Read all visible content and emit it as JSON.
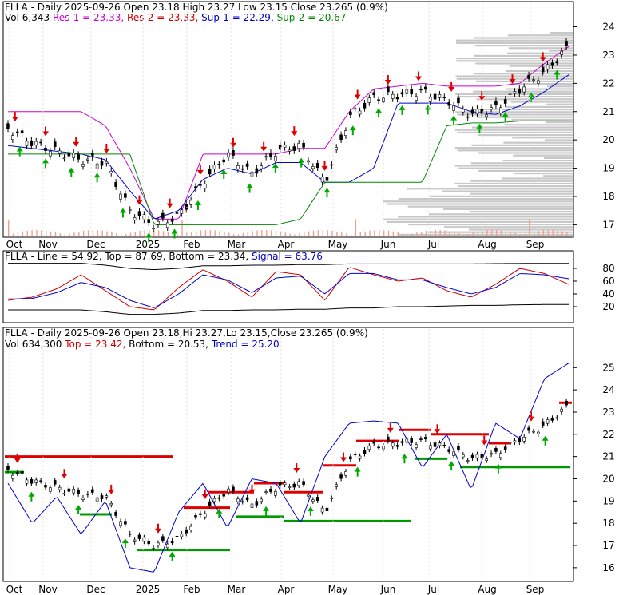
{
  "panels": {
    "top": {
      "header_line1": [
        {
          "text": "FLLA - Daily 2025-09-26 Open 23.18  High 23.27  Low 23.15  Close 23.265 (0.9%)",
          "color": "#000000"
        }
      ],
      "header_line2": [
        {
          "text": "Vol 6,343",
          "color": "#000000"
        },
        {
          "text": "Res-1 = 23.33,",
          "color": "#cc00cc"
        },
        {
          "text": "Res-2 = 23.33,",
          "color": "#cc0000"
        },
        {
          "text": "Sup-1 = 22.29,",
          "color": "#0000cc"
        },
        {
          "text": "Sup-2 = 20.67",
          "color": "#008800"
        }
      ],
      "y_ticks": [
        "24",
        "23",
        "22",
        "21",
        "20",
        "19",
        "18",
        "17"
      ],
      "x_ticks": [
        "Oct",
        "Nov",
        "Dec",
        "2025",
        "Feb",
        "Mar",
        "Apr",
        "May",
        "Jun",
        "Jul",
        "Aug",
        "Sep"
      ]
    },
    "middle": {
      "header": [
        {
          "text": "FLLA - Line = 54.92,",
          "color": "#000000"
        },
        {
          "text": "Top = 87.69,",
          "color": "#000000"
        },
        {
          "text": "Bottom = 23.34,",
          "color": "#000000"
        },
        {
          "text": "Signal = 63.76",
          "color": "#0000cc"
        }
      ],
      "y_ticks": [
        "80",
        "60",
        "40",
        "20"
      ]
    },
    "bottom": {
      "header_line1": [
        {
          "text": "FLLA - Daily 2025-09-26 Open 23.18,Hi 23.27,Lo 23.15,Close 23.265 (0.9%)",
          "color": "#000000"
        }
      ],
      "header_line2": [
        {
          "text": "Vol 634,300",
          "color": "#000000"
        },
        {
          "text": "Top = 23.42,",
          "color": "#cc0000"
        },
        {
          "text": "Bottom = 20.53,",
          "color": "#000000"
        },
        {
          "text": "Trend = 25.20",
          "color": "#0000cc"
        }
      ],
      "y_ticks": [
        "25",
        "24",
        "23",
        "22",
        "21",
        "20",
        "19",
        "18",
        "17",
        "16"
      ],
      "x_ticks": [
        "Oct",
        "Nov",
        "Dec",
        "2025",
        "Feb",
        "Mar",
        "Apr",
        "May",
        "Jun",
        "Jul",
        "Aug",
        "Sep"
      ]
    }
  },
  "chart_data": [
    {
      "type": "line",
      "panel": "price",
      "title": "FLLA - Daily 2025-09-26",
      "ylim": [
        16.7,
        24.1
      ],
      "x": [
        "Oct",
        "Oct",
        "Nov",
        "Nov",
        "Dec",
        "Dec",
        "2025",
        "2025",
        "Feb",
        "Feb",
        "Mar",
        "Mar",
        "Apr",
        "Apr",
        "May",
        "May",
        "Jun",
        "Jun",
        "Jul",
        "Jul",
        "Aug",
        "Aug",
        "Sep",
        "Sep"
      ],
      "series": [
        {
          "name": "Close",
          "values": [
            20.4,
            19.9,
            19.6,
            19.3,
            19.2,
            17.5,
            17.0,
            17.3,
            18.5,
            19.5,
            18.8,
            19.6,
            19.8,
            18.5,
            20.8,
            21.5,
            21.6,
            21.7,
            21.4,
            20.9,
            21.1,
            21.8,
            22.4,
            23.3
          ]
        },
        {
          "name": "Res-1",
          "values": [
            21.0,
            21.0,
            21.0,
            21.0,
            20.5,
            19.0,
            17.2,
            17.2,
            19.5,
            19.5,
            19.5,
            19.5,
            19.7,
            19.7,
            21.0,
            21.8,
            21.9,
            22.0,
            21.9,
            21.9,
            21.9,
            22.0,
            22.7,
            23.3
          ]
        },
        {
          "name": "Sup-1",
          "values": [
            19.8,
            19.7,
            19.6,
            19.5,
            19.3,
            18.2,
            17.2,
            17.5,
            18.6,
            19.0,
            18.8,
            19.2,
            19.2,
            18.5,
            18.5,
            19.0,
            21.3,
            21.3,
            21.3,
            21.0,
            20.9,
            21.2,
            21.7,
            22.3
          ]
        },
        {
          "name": "Sup-2",
          "values": [
            19.5,
            19.5,
            19.5,
            19.5,
            19.5,
            19.5,
            17.0,
            17.0,
            17.0,
            17.0,
            17.0,
            17.0,
            17.2,
            18.5,
            18.5,
            18.5,
            18.5,
            18.5,
            20.5,
            20.6,
            20.6,
            20.67,
            20.67,
            20.67
          ]
        }
      ],
      "annotations": {
        "up_arrows": 22,
        "down_arrows": 18
      }
    },
    {
      "type": "line",
      "panel": "oscillator",
      "ylim": [
        0,
        100
      ],
      "series": [
        {
          "name": "Line",
          "values": [
            30,
            35,
            48,
            70,
            45,
            20,
            15,
            50,
            78,
            60,
            35,
            75,
            70,
            30,
            82,
            70,
            60,
            65,
            45,
            35,
            55,
            80,
            72,
            54.92
          ]
        },
        {
          "name": "Signal",
          "values": [
            32,
            33,
            42,
            58,
            50,
            30,
            18,
            40,
            70,
            62,
            42,
            65,
            68,
            40,
            72,
            72,
            62,
            62,
            50,
            40,
            50,
            72,
            70,
            63.76
          ]
        },
        {
          "name": "Top",
          "values": [
            88,
            88,
            88,
            88,
            85,
            80,
            78,
            80,
            84,
            84,
            85,
            85,
            86,
            86,
            87,
            87,
            87,
            87,
            87,
            87,
            87.5,
            87.69,
            87.69,
            87.69
          ]
        },
        {
          "name": "Bottom",
          "values": [
            15,
            15,
            15,
            15,
            12,
            8,
            8,
            10,
            14,
            14,
            15,
            15,
            16,
            16,
            18,
            18,
            20,
            20,
            21,
            22,
            22,
            23,
            23.34,
            23.34
          ]
        }
      ]
    },
    {
      "type": "line",
      "panel": "price2",
      "title": "FLLA - Daily 2025-09-26",
      "ylim": [
        15.6,
        25.8
      ],
      "series": [
        {
          "name": "Close",
          "values": [
            20.4,
            19.9,
            19.6,
            19.3,
            19.2,
            17.5,
            17.0,
            17.3,
            18.5,
            19.5,
            18.8,
            19.6,
            19.8,
            18.5,
            20.8,
            21.5,
            21.6,
            21.7,
            21.4,
            20.9,
            21.1,
            21.8,
            22.4,
            23.3
          ]
        },
        {
          "name": "Trend",
          "values": [
            19.8,
            18.0,
            19.2,
            17.5,
            19.0,
            16.0,
            15.8,
            18.5,
            19.8,
            17.8,
            20.0,
            19.8,
            18.0,
            21.0,
            22.5,
            22.6,
            22.5,
            20.5,
            22.0,
            19.5,
            22.5,
            21.8,
            24.5,
            25.2
          ]
        }
      ],
      "levels": [
        {
          "name": "Resistance",
          "value": 21.0,
          "color": "#dd0000"
        },
        {
          "name": "Top",
          "value": 23.42,
          "color": "#dd0000"
        },
        {
          "name": "Bottom",
          "value": 20.53,
          "color": "#009900"
        }
      ]
    }
  ]
}
